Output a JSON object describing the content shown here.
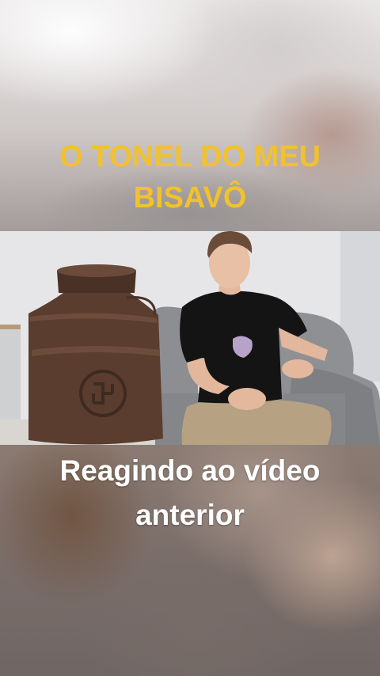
{
  "overlay": {
    "title_line_1": "O TONEL DO MEU",
    "title_line_2": "BISAVÔ",
    "subtitle_line_1": "Reagindo ao vídeo",
    "subtitle_line_2": "anterior"
  },
  "colors": {
    "title": "#f2c12e",
    "subtitle": "#ffffff"
  },
  "video": {
    "scene_elements": [
      "metal-barrel",
      "person",
      "gray-sofa",
      "white-wall"
    ]
  }
}
